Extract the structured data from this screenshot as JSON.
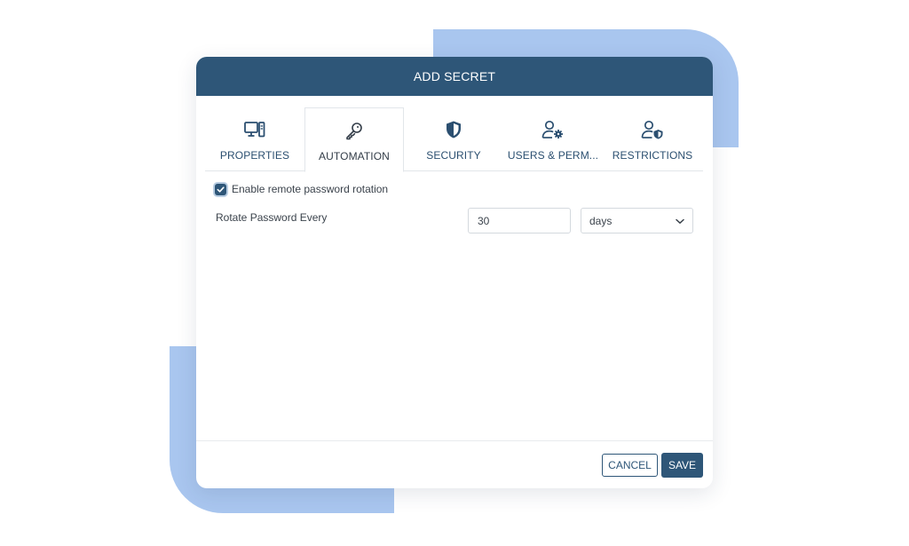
{
  "modal": {
    "title": "ADD SECRET"
  },
  "tabs": [
    {
      "label": "PROPERTIES",
      "icon": "computer-icon",
      "active": false
    },
    {
      "label": "AUTOMATION",
      "icon": "key-icon",
      "active": true
    },
    {
      "label": "SECURITY",
      "icon": "shield-icon",
      "active": false
    },
    {
      "label": "USERS & PERM...",
      "icon": "user-gear-icon",
      "active": false
    },
    {
      "label": "RESTRICTIONS",
      "icon": "user-shield-icon",
      "active": false
    }
  ],
  "automation": {
    "enable_rotation": {
      "label": "Enable remote password rotation",
      "checked": true
    },
    "rotate_label": "Rotate Password Every",
    "interval_value": "30",
    "interval_unit": "days"
  },
  "footer": {
    "cancel_label": "CANCEL",
    "save_label": "SAVE"
  },
  "colors": {
    "primary": "#2e5678",
    "decoration": "#a9c6ef"
  }
}
